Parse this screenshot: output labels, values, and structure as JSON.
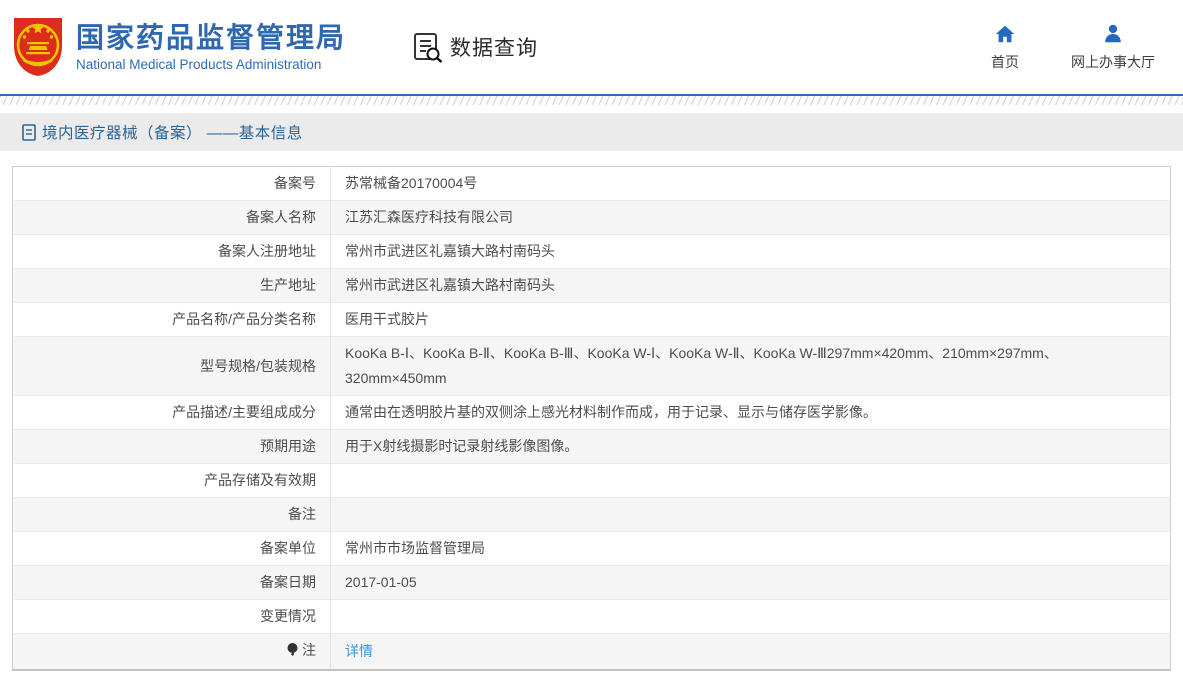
{
  "header": {
    "brand": {
      "title_cn": "国家药品监督管理局",
      "title_en": "National Medical Products Administration"
    },
    "query_label": "数据查询",
    "nav": [
      {
        "icon": "home-icon",
        "label": "首页"
      },
      {
        "icon": "person-icon",
        "label": "网上办事大厅"
      }
    ]
  },
  "breadcrumb": {
    "label": "境内医疗器械（备案） ——基本信息"
  },
  "table": {
    "rows": [
      {
        "label": "备案号",
        "value": "苏常械备20170004号"
      },
      {
        "label": "备案人名称",
        "value": "江苏汇森医疗科技有限公司"
      },
      {
        "label": "备案人注册地址",
        "value": "常州市武进区礼嘉镇大路村南码头"
      },
      {
        "label": "生产地址",
        "value": "常州市武进区礼嘉镇大路村南码头"
      },
      {
        "label": "产品名称/产品分类名称",
        "value": "医用干式胶片"
      },
      {
        "label": "型号规格/包装规格",
        "value": "KooKa B-Ⅰ、KooKa B-Ⅱ、KooKa B-Ⅲ、KooKa W-Ⅰ、KooKa W-Ⅱ、KooKa W-Ⅲ297mm×420mm、210mm×297mm、320mm×450mm"
      },
      {
        "label": "产品描述/主要组成成分",
        "value": "通常由在透明胶片基的双侧涂上感光材料制作而成，用于记录、显示与储存医学影像。"
      },
      {
        "label": "预期用途",
        "value": "用于X射线摄影时记录射线影像图像。"
      },
      {
        "label": "产品存储及有效期",
        "value": ""
      },
      {
        "label": "备注",
        "value": ""
      },
      {
        "label": "备案单位",
        "value": "常州市市场监督管理局"
      },
      {
        "label": "备案日期",
        "value": "2017-01-05"
      },
      {
        "label": "变更情况",
        "value": ""
      },
      {
        "label": "注",
        "label_icon": "bulb-icon",
        "value": "详情",
        "value_is_link": true
      }
    ]
  },
  "colors": {
    "accent_blue": "#2e68b0",
    "divider_blue": "#2f6db8",
    "link_blue": "#3a95d9",
    "crumb_blue": "#2a6496",
    "row_alt_gray": "#f5f5f5",
    "band_gray": "#ebebeb",
    "emblem_red": "#dd2b1c",
    "emblem_gold": "#f5c400"
  }
}
